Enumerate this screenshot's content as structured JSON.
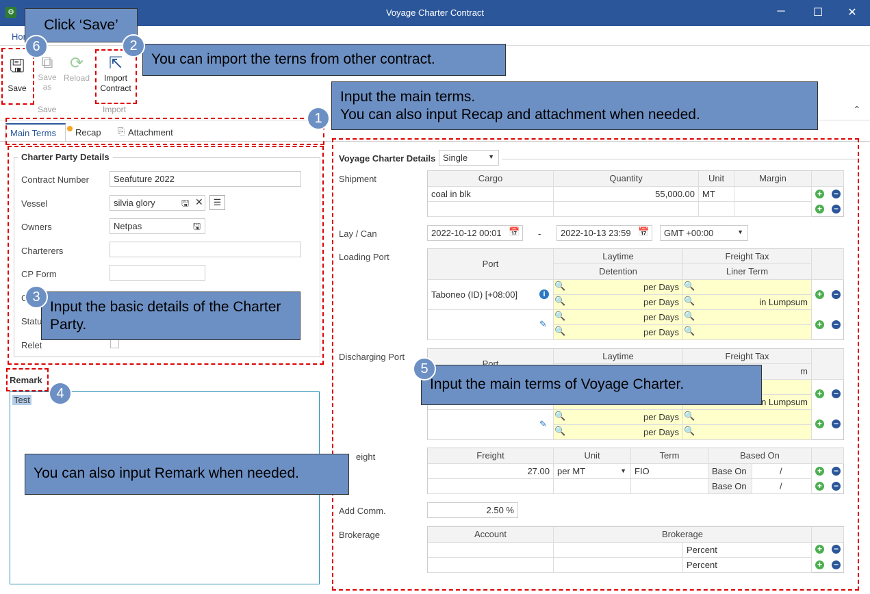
{
  "window": {
    "title": "Voyage Charter Contract",
    "minimize": "─",
    "maximize": "☐",
    "close": "✕"
  },
  "ribbon": {
    "home_tab": "Home",
    "save": "Save",
    "save_as": "Save as",
    "reload": "Reload",
    "import_contract": "Import Contract",
    "group_save": "Save",
    "group_import": "Import",
    "collapse": "⌃"
  },
  "tabs": [
    "Main Terms",
    "Recap",
    "Attachment"
  ],
  "cp": {
    "title": "Charter Party Details",
    "labels": {
      "contract_number": "Contract Number",
      "vessel": "Vessel",
      "owners": "Owners",
      "charterers": "Charterers",
      "cp_form": "CP Form",
      "cp_date": "C",
      "status": "Statu",
      "relet": "Relet"
    },
    "values": {
      "contract_number": "Seafuture 2022",
      "vessel": "silvia glory",
      "owners": "Netpas",
      "charterers": "",
      "cp_form": ""
    }
  },
  "remark": {
    "title": "Remark",
    "text": "Test"
  },
  "voyage": {
    "title": "Voyage Charter Details",
    "mode": "Single",
    "shipment": {
      "label": "Shipment",
      "headers": [
        "Cargo",
        "Quantity",
        "Unit",
        "Margin"
      ],
      "rows": [
        [
          "coal in blk",
          "55,000.00",
          "MT",
          ""
        ],
        [
          "",
          "",
          "",
          ""
        ]
      ]
    },
    "laycan": {
      "label": "Lay / Can",
      "from": "2022-10-12 00:01",
      "dash": "-",
      "to": "2022-10-13 23:59",
      "tz": "GMT +00:00"
    },
    "loading": {
      "label": "Loading Port",
      "h_port": "Port",
      "h_laytime": "Laytime",
      "h_detention": "Detention",
      "h_freight_tax": "Freight Tax",
      "h_liner": "Liner Term",
      "port": "Taboneo (ID) [+08:00]",
      "per_days": "per Days",
      "lumpsum": "in Lumpsum"
    },
    "discharging": {
      "label": "Discharging Port",
      "h_port": "Port",
      "h_laytime": "Laytime",
      "h_freight_tax": "Freight Tax",
      "h_liner_frag": "m",
      "lumpsum_frag": "n Lumpsum",
      "per_days": "per Days"
    },
    "freight": {
      "label": "eight",
      "headers": [
        "Freight",
        "Unit",
        "Term",
        "Based On"
      ],
      "rows": [
        {
          "freight": "27.00",
          "unit": "per MT",
          "term": "FIO",
          "based": "Base On",
          "slash": "/"
        },
        {
          "freight": "",
          "unit": "",
          "term": "",
          "based": "Base On",
          "slash": "/"
        }
      ]
    },
    "add_comm": {
      "label": "Add Comm.",
      "value": "2.50 %"
    },
    "brokerage": {
      "label": "Brokerage",
      "headers": [
        "Account",
        "Brokerage"
      ],
      "rows": [
        "Percent",
        "Percent"
      ]
    }
  },
  "callouts": {
    "c6": "Click ‘Save’",
    "c2": "You can import the terns from other contract.",
    "c1a": "Input the main terms.",
    "c1b": "You can also input Recap and attachment when needed.",
    "c3": "Input the basic details of the Charter Party.",
    "c4": "You can also input Remark when needed.",
    "c5": "Input the main terms of Voyage Charter."
  },
  "nums": {
    "n1": "1",
    "n2": "2",
    "n3": "3",
    "n4": "4",
    "n5": "5",
    "n6": "6"
  }
}
